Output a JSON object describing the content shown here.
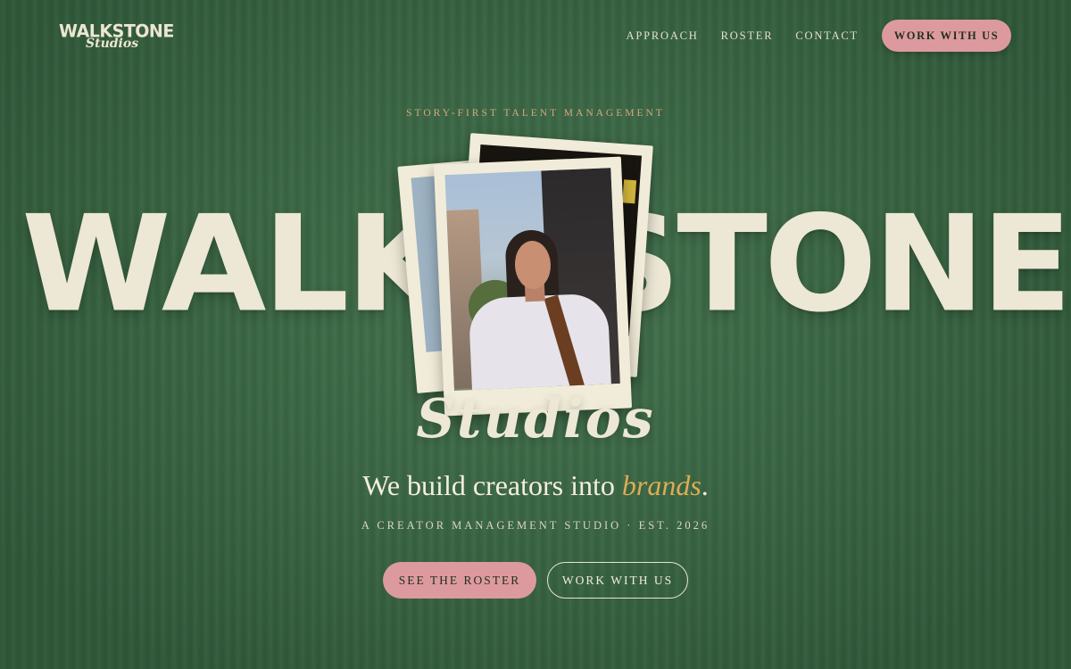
{
  "logo": {
    "main": "WALKSTONE",
    "sub": "Studios"
  },
  "nav": {
    "links": [
      "APPROACH",
      "ROSTER",
      "CONTACT"
    ],
    "cta_label": "WORK WITH US"
  },
  "hero": {
    "kicker": "STORY-FIRST TALENT MANAGEMENT",
    "word_left": "WALK",
    "word_right": "STONE",
    "script_word": "Studios",
    "tagline_pre": "We build creators into ",
    "tagline_emph": "brands",
    "tagline_post": ".",
    "subline": "A CREATOR MANAGEMENT STUDIO · EST. 2026",
    "primary_button": "SEE THE ROSTER",
    "secondary_button": "WORK WITH US"
  },
  "colors": {
    "background": "#3a6b45",
    "cream": "#ede7d5",
    "pink_accent": "#dc9a9f",
    "gold_accent": "#dcac55"
  }
}
